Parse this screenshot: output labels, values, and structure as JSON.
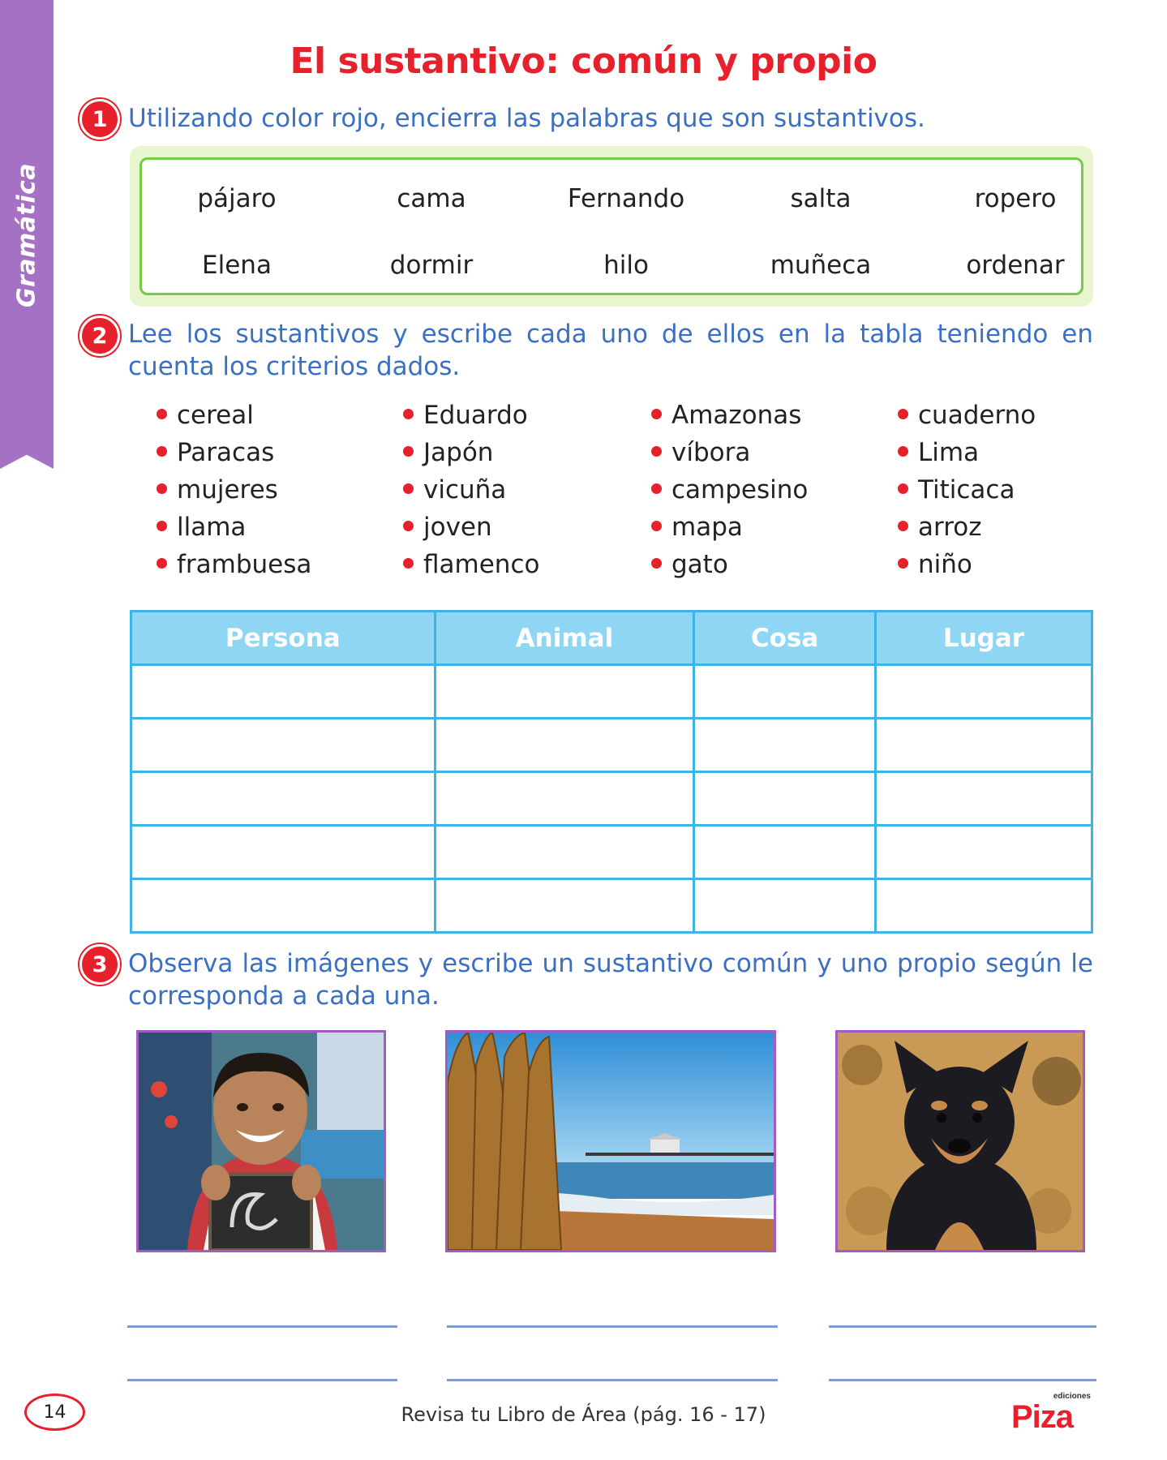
{
  "side_tab": {
    "label": "Gramática"
  },
  "title": "El sustantivo: común y propio",
  "exercise1": {
    "number": "1",
    "instruction": "Utilizando color rojo, encierra las palabras que son sustantivos.",
    "words_row1": [
      "pájaro",
      "cama",
      "Fernando",
      "salta",
      "ropero"
    ],
    "words_row2": [
      "Elena",
      "dormir",
      "hilo",
      "muñeca",
      "ordenar"
    ]
  },
  "exercise2": {
    "number": "2",
    "instruction": "Lee los sustantivos y escribe cada uno de ellos en la tabla teniendo en cuenta los criterios dados.",
    "columns": [
      [
        "cereal",
        "Paracas",
        "mujeres",
        "llama",
        "frambuesa"
      ],
      [
        "Eduardo",
        "Japón",
        "vicuña",
        "joven",
        "flamenco"
      ],
      [
        "Amazonas",
        "víbora",
        "campesino",
        "mapa",
        "gato"
      ],
      [
        "cuaderno",
        "Lima",
        "Titicaca",
        "arroz",
        "niño"
      ]
    ],
    "table_headers": [
      "Persona",
      "Animal",
      "Cosa",
      "Lugar"
    ]
  },
  "exercise3": {
    "number": "3",
    "instruction": "Observa las imágenes y escribe un sustantivo común y uno propio según le corresponda a cada una."
  },
  "footer": {
    "page_number": "14",
    "text": "Revisa tu Libro de Área (pág. 16 - 17)",
    "logo_small": "ediciones",
    "logo_main": "Piza"
  },
  "colors": {
    "title_red": "#e6212b",
    "instruction_blue": "#3a6fc2",
    "side_tab_purple": "#a471c5",
    "table_border": "#3cb4e6",
    "table_header_bg": "#8ed6f4",
    "word_box_green": "#7ac943"
  }
}
